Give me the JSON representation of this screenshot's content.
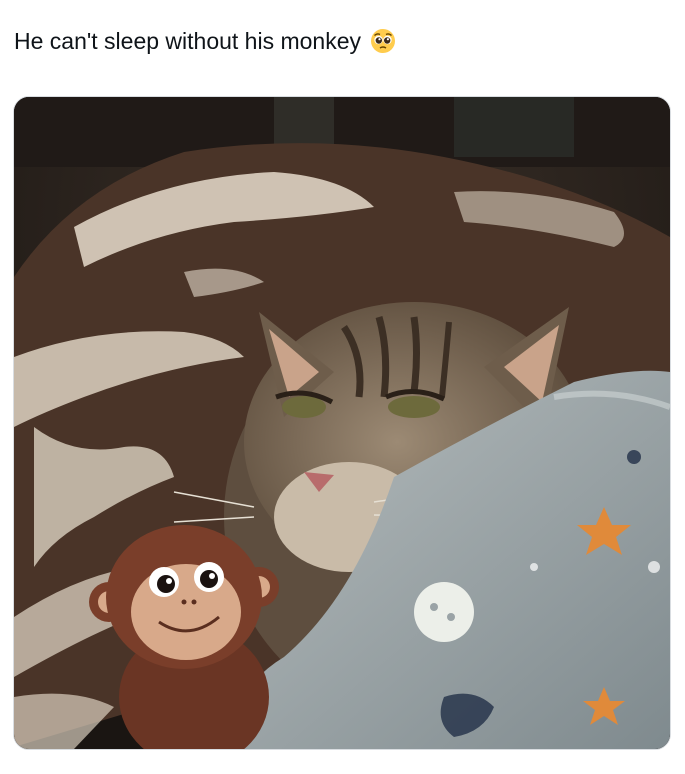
{
  "post": {
    "text": "He can't sleep without his monkey",
    "emoji": "pleading-face"
  },
  "media": {
    "alt_description": "",
    "colors": {
      "sweater_dark": "#4a3428",
      "sweater_light": "#e6dccb",
      "cat_fur": "#7a6a58",
      "blanket": "#9aa3a6",
      "monkey": "#7a3e2a",
      "star": "#e08a3a"
    }
  }
}
